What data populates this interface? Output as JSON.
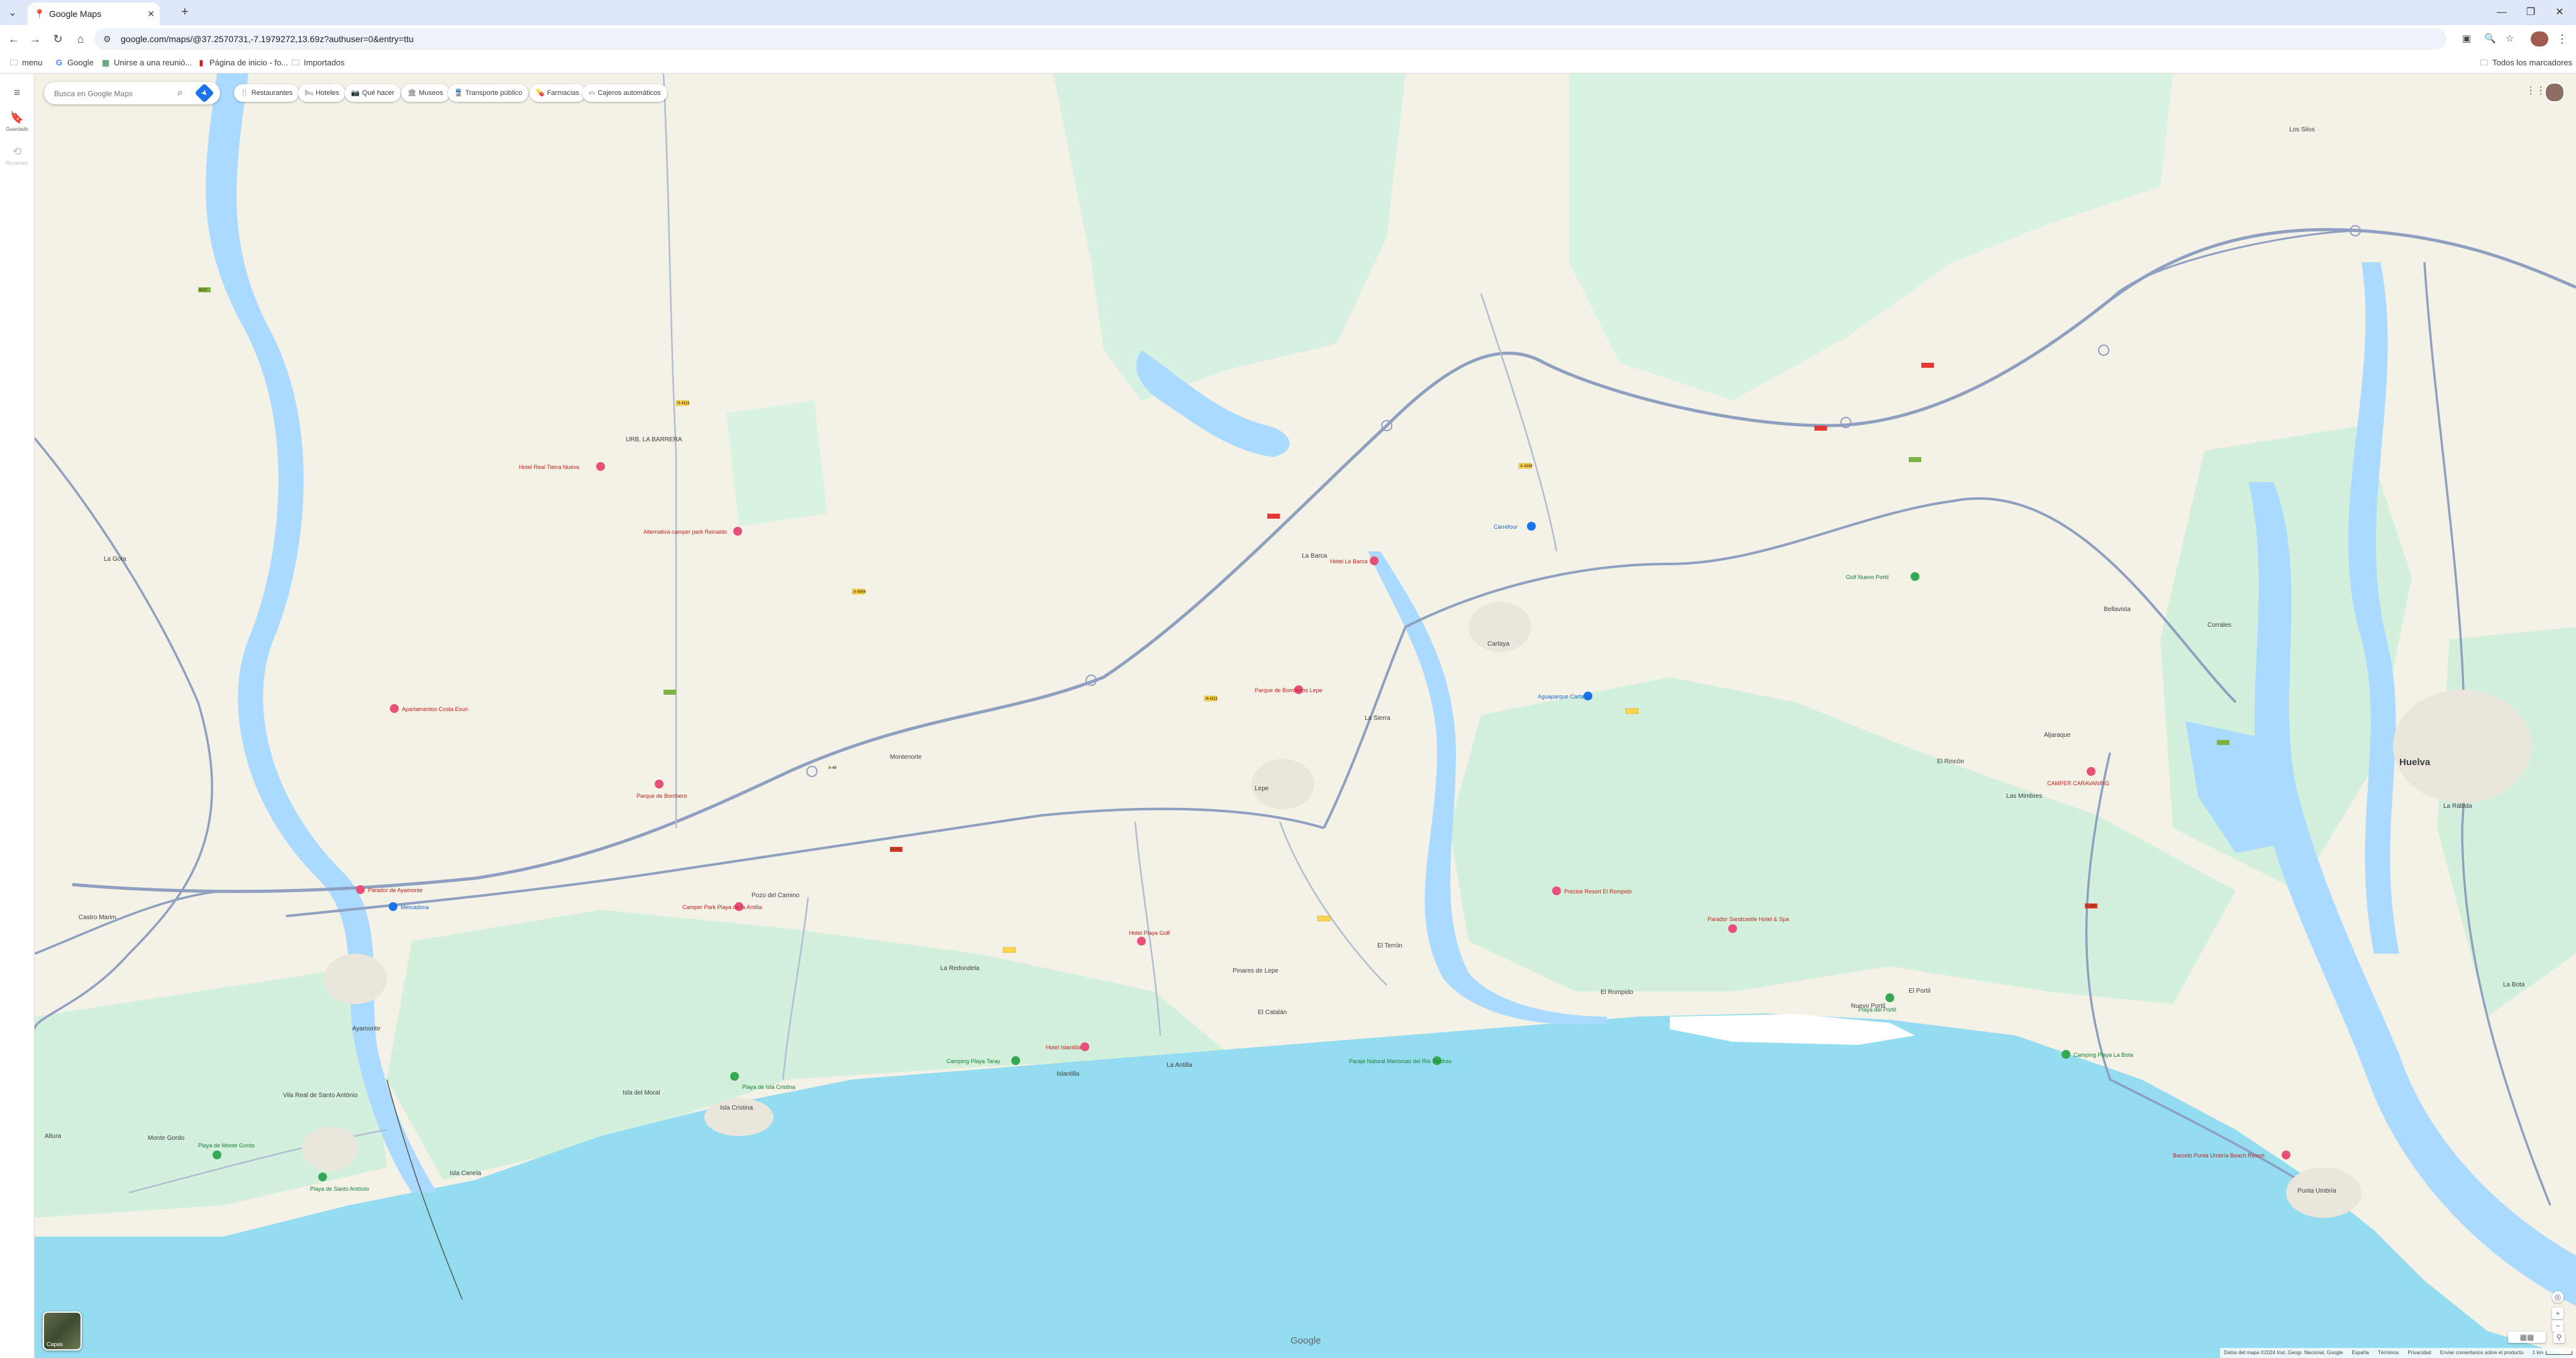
{
  "browser": {
    "tab_title": "Google Maps",
    "tab_icon": "google-maps-pin-icon",
    "url": "google.com/maps/@37.2570731,-7.1979272,13.69z?authuser=0&entry=ttu",
    "bookmarks": [
      {
        "label": "menu",
        "icon": "folder-icon"
      },
      {
        "label": "Google",
        "icon": "google-icon"
      },
      {
        "label": "Unirse a una reunió...",
        "icon": "app-grid-icon"
      },
      {
        "label": "Página de inicio - fo...",
        "icon": "bookmark-red-icon"
      },
      {
        "label": "Importados",
        "icon": "folder-icon"
      }
    ],
    "all_bookmarks": "Todos los marcadores"
  },
  "maps": {
    "search_placeholder": "Busca en Google Maps",
    "rail": {
      "saved": "Guardado",
      "recents": "Recientes"
    },
    "chips": [
      {
        "label": "Restaurantes",
        "icon": "🍴"
      },
      {
        "label": "Hoteles",
        "icon": "🛏"
      },
      {
        "label": "Qué hacer",
        "icon": "📷"
      },
      {
        "label": "Museos",
        "icon": "🏛"
      },
      {
        "label": "Transporte público",
        "icon": "🚆"
      },
      {
        "label": "Farmacias",
        "icon": "💊"
      },
      {
        "label": "Cajeros automáticos",
        "icon": "▭"
      }
    ],
    "layers_label": "Capas",
    "google_logo": "Google",
    "attribution": [
      "Datos del mapa ©2024 Inst. Geogr. Nacional, Google",
      "España",
      "Términos",
      "Privacidad",
      "Enviar comentarios sobre el producto",
      "1 km"
    ],
    "colors": {
      "sea": "#94dcef",
      "land": "#f4f1e7",
      "park": "#cdeedc",
      "road": "#8e9fbf",
      "water": "#aadaff"
    },
    "towns": {
      "huelva": "Huelva",
      "lepe": "Lepe",
      "cartaya": "Cartaya",
      "isla_cristina": "Isla Cristina",
      "ayamonte": "Ayamonte",
      "punta_umbria": "Punta Umbría",
      "aljaraque": "Aljaraque",
      "el_rompido": "El Rompido",
      "islantilla": "Islantilla",
      "la_antilla": "La Antilla",
      "montegordo": "Monte Gordo",
      "villa_real": "Vila Real de Santo António",
      "bellavista": "Bellavista",
      "el_portil": "El Portil",
      "nuevo_portil": "Nuevo Portil",
      "la_redondela": "La Redondela",
      "montenorte": "Montenorte",
      "el_terron": "El Terrón",
      "pinares": "Pinares de Lepe",
      "el_catalan": "El Catalán",
      "la_barca": "La Barca",
      "los_silos": "Los Silos",
      "la_rabida": "La Rábida",
      "el_rincon": "El Rincón",
      "las_mimbres": "Las Mimbres",
      "corrales": "Corrales",
      "castro_marim": "Castro Marim",
      "pozo_del_camino": "Pozo del Camino",
      "urb_la_barrera": "URB. LA BARRERA",
      "la_gota": "La Gota",
      "la_sierra": "La Sierra",
      "punta_del_moral": "Isla del Moral",
      "la_bota": "La Bota",
      "isla_canela": "Isla Canela",
      "altura": "Altura"
    },
    "pois": [
      "Hotel Real Tierra Nueva",
      "Alternativa camper park Reinaldo",
      "Apartamentos Costa Esuri",
      "Parque de Bombero",
      "Parador de Ayamonte",
      "Mercadona",
      "Camper Park Playa de la Antilla",
      "Hotel Islantilla",
      "Camping Playa Taray",
      "Playa de Isla Cristina",
      "Hotel Playa Golf",
      "Hotel Le Barca",
      "Parque de Bomberos Lepe",
      "Carrefour",
      "Aguaparque Cartaya",
      "Golf Nuevo Portil",
      "Precise Resort El Rompido",
      "Parador Sandcastle Hotel & Spa",
      "Playa del Portil",
      "Camping Playa La Bota",
      "Barceló Punta Umbría Beach Resort",
      "CAMPER CARAVANING",
      "Playa de Santo António",
      "Playa de Monte Gordo",
      "Paraje Natural Marismas del Río Piedras"
    ],
    "road_labels": [
      "A-49",
      "N-431",
      "H-4113",
      "A-5054",
      "H-4111",
      "A-497",
      "IC27",
      "A-4150"
    ]
  }
}
